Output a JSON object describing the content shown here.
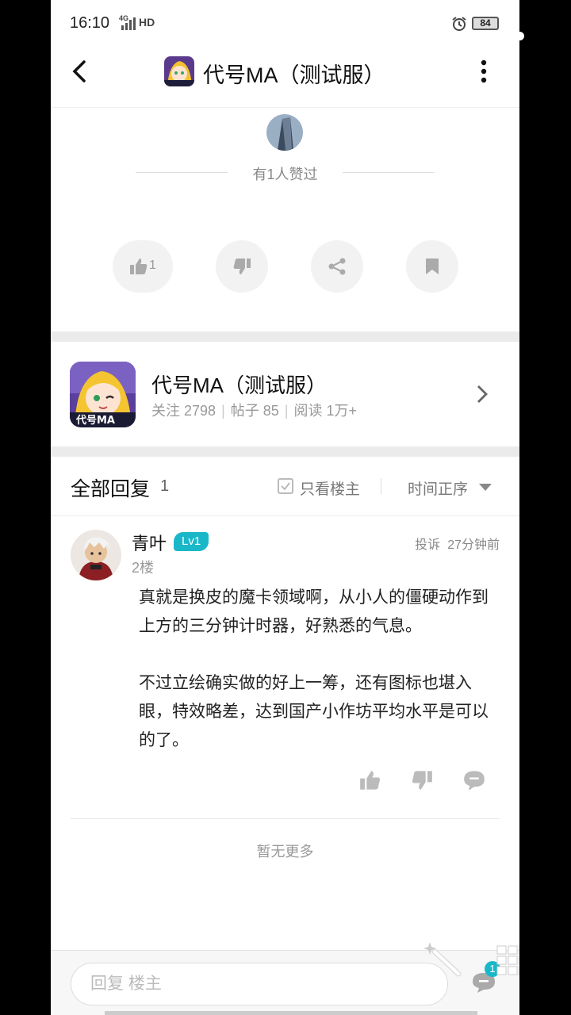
{
  "status_bar": {
    "time": "16:10",
    "network": "4G",
    "hd": "HD",
    "battery": "84"
  },
  "header": {
    "title": "代号MA（测试服）"
  },
  "likes": {
    "liked_by_text": "有1人赞过"
  },
  "actions": {
    "like_count": "1"
  },
  "game_card": {
    "name": "代号MA（测试服）",
    "follow_label": "关注",
    "follow_count": "2798",
    "posts_label": "帖子",
    "posts_count": "85",
    "reads_label": "阅读",
    "reads_count": "1万+",
    "icon_text": "代号MA"
  },
  "replies_header": {
    "title": "全部回复",
    "count": "1",
    "only_author": "只看楼主",
    "sort": "时间正序"
  },
  "comment": {
    "username": "青叶",
    "level": "Lv1",
    "floor": "2楼",
    "report": "投诉",
    "time": "27分钟前",
    "paragraph1": "真就是换皮的魔卡领域啊，从小人的僵硬动作到上方的三分钟计时器，好熟悉的气息。",
    "paragraph2": "不过立绘确实做的好上一筹，还有图标也堪入眼，特效略差，达到国产小作坊平均水平是可以的了。"
  },
  "no_more": "暂无更多",
  "bottom_bar": {
    "reply_placeholder": "回复  楼主",
    "reply_badge": "1"
  },
  "colors": {
    "accent": "#1ab7c9",
    "separator": "#ebebeb",
    "muted_text": "#999999"
  }
}
